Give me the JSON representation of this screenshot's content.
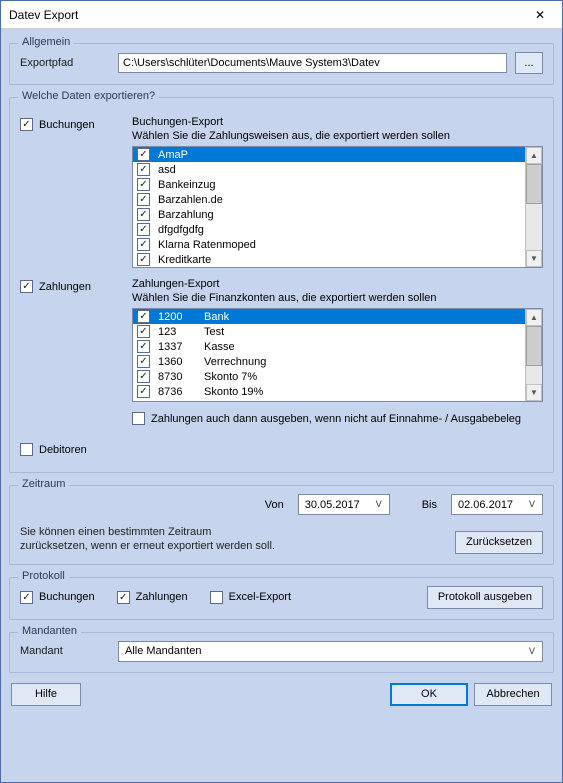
{
  "window": {
    "title": "Datev Export"
  },
  "allgemein": {
    "legend": "Allgemein",
    "exportpfad_label": "Exportpfad",
    "exportpfad_value": "C:\\Users\\schlüter\\Documents\\Mauve System3\\Datev",
    "browse_label": "..."
  },
  "export": {
    "legend": "Welche Daten exportieren?",
    "buchungen": {
      "checkbox_label": "Buchungen",
      "title": "Buchungen-Export",
      "subtitle": "Wählen Sie die Zahlungsweisen aus, die exportiert werden sollen",
      "items": [
        {
          "label": "AmaP",
          "checked": true,
          "selected": true
        },
        {
          "label": "asd",
          "checked": true
        },
        {
          "label": "Bankeinzug",
          "checked": true
        },
        {
          "label": "Barzahlen.de",
          "checked": true
        },
        {
          "label": "Barzahlung",
          "checked": true
        },
        {
          "label": "dfgdfgdfg",
          "checked": true
        },
        {
          "label": "Klarna Ratenmoped",
          "checked": true
        },
        {
          "label": "Kreditkarte",
          "checked": true
        }
      ]
    },
    "zahlungen": {
      "checkbox_label": "Zahlungen",
      "title": "Zahlungen-Export",
      "subtitle": "Wählen Sie die Finanzkonten aus, die exportiert werden sollen",
      "items": [
        {
          "acct": "1200",
          "label": "Bank",
          "checked": true,
          "selected": true
        },
        {
          "acct": "123",
          "label": "Test",
          "checked": true
        },
        {
          "acct": "1337",
          "label": "Kasse",
          "checked": true
        },
        {
          "acct": "1360",
          "label": "Verrechnung",
          "checked": true
        },
        {
          "acct": "8730",
          "label": "Skonto 7%",
          "checked": true
        },
        {
          "acct": "8736",
          "label": "Skonto 19%",
          "checked": true
        }
      ],
      "extra_checkbox_label": "Zahlungen auch dann ausgeben, wenn nicht auf Einnahme- / Ausgabebeleg"
    },
    "debitoren_label": "Debitoren"
  },
  "zeitraum": {
    "legend": "Zeitraum",
    "von_label": "Von",
    "von_value": "30.05.2017",
    "bis_label": "Bis",
    "bis_value": "02.06.2017",
    "hint": "Sie können einen bestimmten Zeitraum zurücksetzen, wenn er erneut exportiert werden soll.",
    "reset_button": "Zurücksetzen"
  },
  "protokoll": {
    "legend": "Protokoll",
    "buchungen_label": "Buchungen",
    "zahlungen_label": "Zahlungen",
    "excel_label": "Excel-Export",
    "output_button": "Protokoll ausgeben"
  },
  "mandanten": {
    "legend": "Mandanten",
    "label": "Mandant",
    "value": "Alle Mandanten"
  },
  "buttons": {
    "help": "Hilfe",
    "ok": "OK",
    "cancel": "Abbrechen"
  },
  "glyphs": {
    "check": "✓",
    "chevron_down": "ᐯ",
    "up": "▲",
    "down": "▼",
    "close": "✕"
  }
}
